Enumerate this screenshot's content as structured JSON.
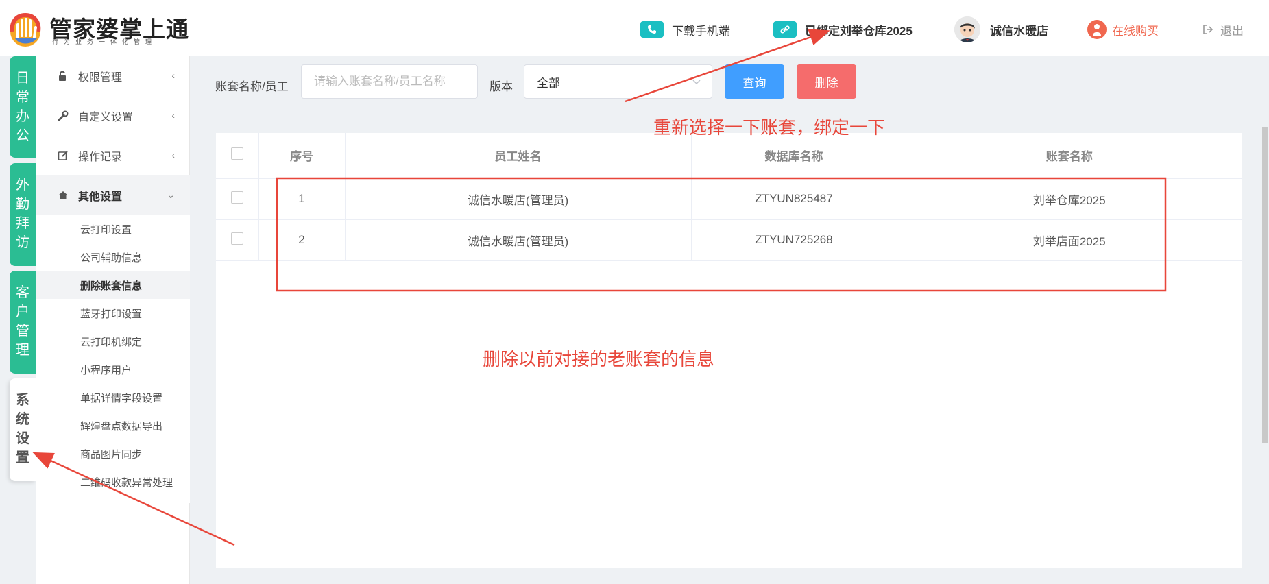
{
  "header": {
    "logo_title": "管家婆掌上通",
    "logo_subtitle": "行为业务一体化管理",
    "download_label": "下载手机端",
    "bound_label": "已绑定刘举仓库2025",
    "user_name": "诚信水暖店",
    "buy_label": "在线购买",
    "logout_label": "退出"
  },
  "left_tabs": [
    {
      "label": "日常办公"
    },
    {
      "label": "外勤拜访"
    },
    {
      "label": "客户管理"
    },
    {
      "label": "系统设置"
    }
  ],
  "sidebar": {
    "items": [
      {
        "label": "权限管理",
        "icon": "lock-icon"
      },
      {
        "label": "自定义设置",
        "icon": "wrench-icon"
      },
      {
        "label": "操作记录",
        "icon": "edit-icon"
      },
      {
        "label": "其他设置",
        "icon": "home-icon"
      }
    ],
    "submenu": [
      {
        "label": "云打印设置"
      },
      {
        "label": "公司辅助信息"
      },
      {
        "label": "删除账套信息"
      },
      {
        "label": "蓝牙打印设置"
      },
      {
        "label": "云打印机绑定"
      },
      {
        "label": "小程序用户"
      },
      {
        "label": "单据详情字段设置"
      },
      {
        "label": "辉煌盘点数据导出"
      },
      {
        "label": "商品图片同步"
      },
      {
        "label": "二维码收款异常处理"
      }
    ]
  },
  "filter": {
    "name_label": "账套名称/员工",
    "name_placeholder": "请输入账套名称/员工名称",
    "version_label": "版本",
    "version_value": "全部",
    "query_label": "查询",
    "delete_label": "删除"
  },
  "table": {
    "columns": [
      "",
      "序号",
      "员工姓名",
      "数据库名称",
      "账套名称"
    ],
    "rows": [
      {
        "index": "1",
        "employee": "诚信水暖店(管理员)",
        "database": "ZTYUN825487",
        "account_set": "刘举仓库2025"
      },
      {
        "index": "2",
        "employee": "诚信水暖店(管理员)",
        "database": "ZTYUN725268",
        "account_set": "刘举店面2025"
      }
    ]
  },
  "annotations": {
    "top_note": "重新选择一下账套，绑定一下",
    "middle_note": "删除以前对接的老账套的信息",
    "color": "#e8463a"
  },
  "colors": {
    "tab_green": "#2bbd93",
    "badge_teal": "#1bbfc2",
    "query_blue": "#409eff",
    "delete_red": "#f56c6c",
    "buy_orange": "#f0674f"
  }
}
